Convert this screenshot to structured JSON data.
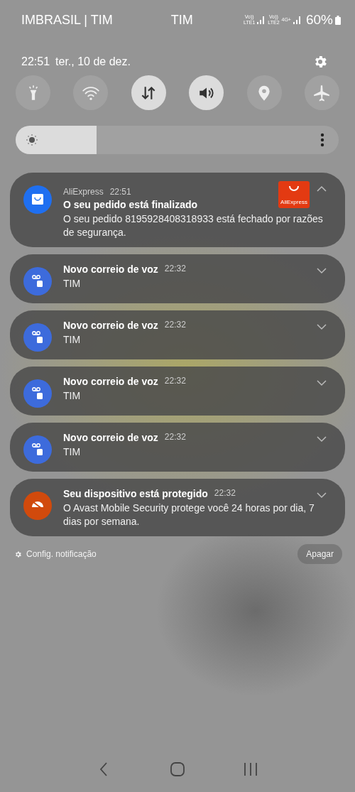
{
  "status_bar": {
    "carrier": "IMBRASIL | TIM",
    "carrier_2": "TIM",
    "sims": [
      {
        "top": "Vo))",
        "bottom": "LTE1"
      },
      {
        "top": "Vo))",
        "bottom": "LTE2",
        "network": "4G+"
      }
    ],
    "battery": "60%"
  },
  "header": {
    "time": "22:51",
    "date": "ter., 10 de dez."
  },
  "quick_tiles": [
    {
      "kind": "flashlight",
      "on": false
    },
    {
      "kind": "wifi",
      "on": false
    },
    {
      "kind": "data",
      "on": true
    },
    {
      "kind": "sound",
      "on": true
    },
    {
      "kind": "location",
      "on": false
    },
    {
      "kind": "airplane",
      "on": false
    }
  ],
  "brightness": {
    "level": 0.25
  },
  "notifications": [
    {
      "kind": "shop",
      "color": "#1f6ff0",
      "app": "AliExpress",
      "time": "22:51",
      "title": "O seu pedido está finalizado",
      "text": "O seu pedido 8195928408318933 está fechado por razões de segurança.",
      "expanded": true,
      "thumbnail_label": "AliExpress"
    },
    {
      "kind": "voicemail",
      "color": "#3d6bdc",
      "title": "Novo correio de voz",
      "time": "22:32",
      "text": "TIM",
      "expanded": false
    },
    {
      "kind": "voicemail",
      "color": "#3d6bdc",
      "title": "Novo correio de voz",
      "time": "22:32",
      "text": "TIM",
      "expanded": false
    },
    {
      "kind": "voicemail",
      "color": "#3d6bdc",
      "title": "Novo correio de voz",
      "time": "22:32",
      "text": "TIM",
      "expanded": false
    },
    {
      "kind": "voicemail",
      "color": "#3d6bdc",
      "title": "Novo correio de voz",
      "time": "22:32",
      "text": "TIM",
      "expanded": false
    },
    {
      "kind": "shield",
      "color": "#d14a0c",
      "title": "Seu dispositivo está protegido",
      "time": "22:32",
      "text": "O Avast Mobile Security protege você 24 horas por dia, 7 dias por semana.",
      "expanded": false
    }
  ],
  "footer": {
    "settings_label": "Config. notificação",
    "clear_button": "Apagar"
  }
}
